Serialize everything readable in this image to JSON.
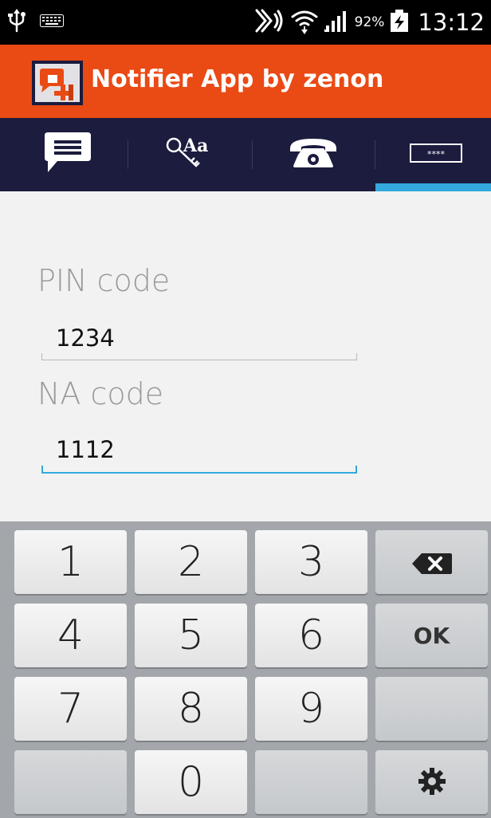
{
  "status_bar": {
    "time": "13:12",
    "battery_percent": "92%",
    "icons": [
      "usb-icon",
      "keyboard-icon",
      "nfc-icon",
      "wifi-icon",
      "signal-icon",
      "battery-charging-icon"
    ]
  },
  "app_bar": {
    "title": "Notifier App by zenon",
    "logo_icon": "zenon-logo-icon",
    "color": "#ea4a14"
  },
  "tabs": [
    {
      "icon": "message-icon",
      "selected": false
    },
    {
      "icon": "key-text-icon",
      "selected": false
    },
    {
      "icon": "phone-icon",
      "selected": false
    },
    {
      "icon": "password-icon",
      "selected": true,
      "label": "****"
    }
  ],
  "form": {
    "pin_label": "PIN code",
    "pin_value": "1234",
    "na_label": "NA code",
    "na_value": "1112"
  },
  "keyboard": {
    "keys": [
      "1",
      "2",
      "3",
      "4",
      "5",
      "6",
      "7",
      "8",
      "9",
      "0"
    ],
    "ok_label": "OK",
    "backspace_icon": "backspace-icon",
    "settings_icon": "gear-icon"
  },
  "colors": {
    "accent": "#33a9de",
    "tab_bar": "#1b1c3e",
    "status_bar": "#000000"
  }
}
